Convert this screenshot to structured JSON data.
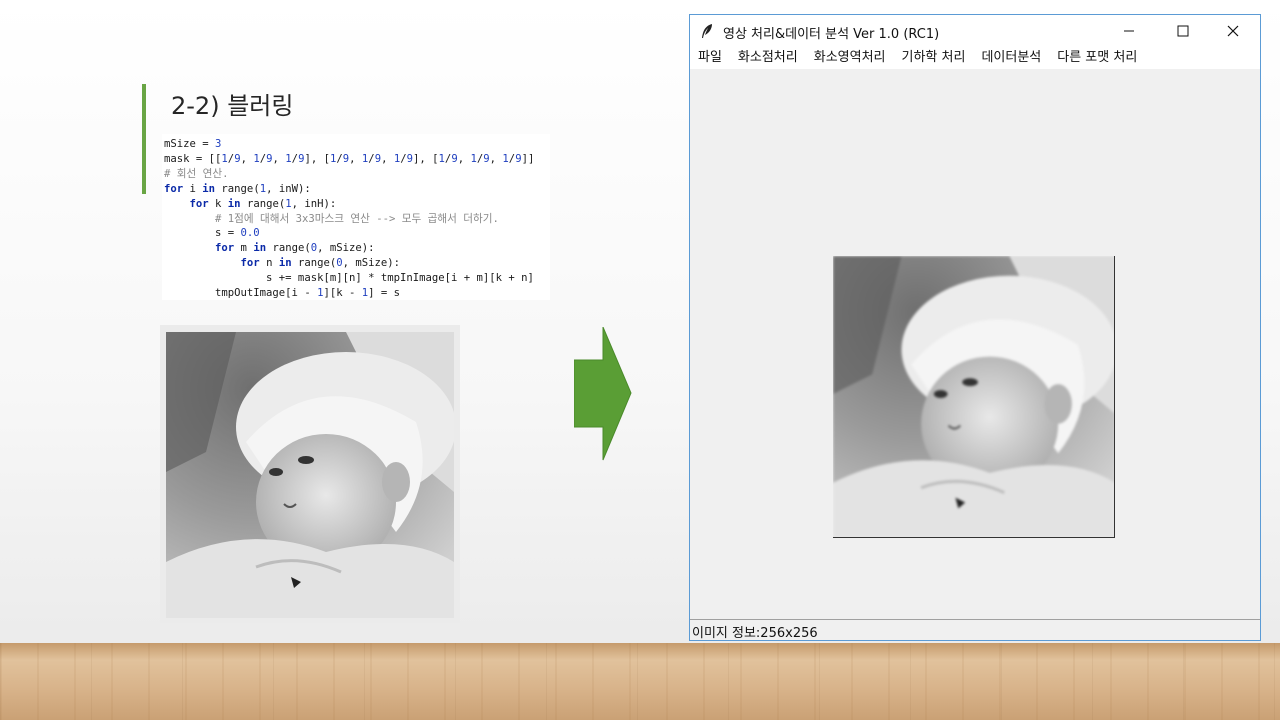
{
  "slide": {
    "title": "2-2) 블러링",
    "code": {
      "lines": [
        "mSize = 3",
        "mask = [[1/9, 1/9, 1/9], [1/9, 1/9, 1/9], [1/9, 1/9, 1/9]]",
        "# 회선 연산.",
        "for i in range(1, inW):",
        "    for k in range(1, inH):",
        "        # 1점에 대해서 3x3마스크 연산 --> 모두 곱해서 더하기.",
        "        s = 0.0",
        "        for m in range(0, mSize):",
        "            for n in range(0, mSize):",
        "                s += mask[m][n] * tmpInImage[i + m][k + n]",
        "        tmpOutImage[i - 1][k - 1] = s"
      ]
    },
    "arrow_color": "#5a9e35",
    "accent_color": "#69a544"
  },
  "window": {
    "title": "영상 처리&데이터 분석 Ver 1.0 (RC1)",
    "icon": "feather-icon",
    "buttons": [
      "minimize-icon",
      "maximize-icon",
      "close-icon"
    ],
    "menu": [
      "파일",
      "화소점처리",
      "화소영역처리",
      "기하학 처리",
      "데이터분석",
      "다른 포맷 처리"
    ],
    "status": "이미지 정보:256x256"
  }
}
